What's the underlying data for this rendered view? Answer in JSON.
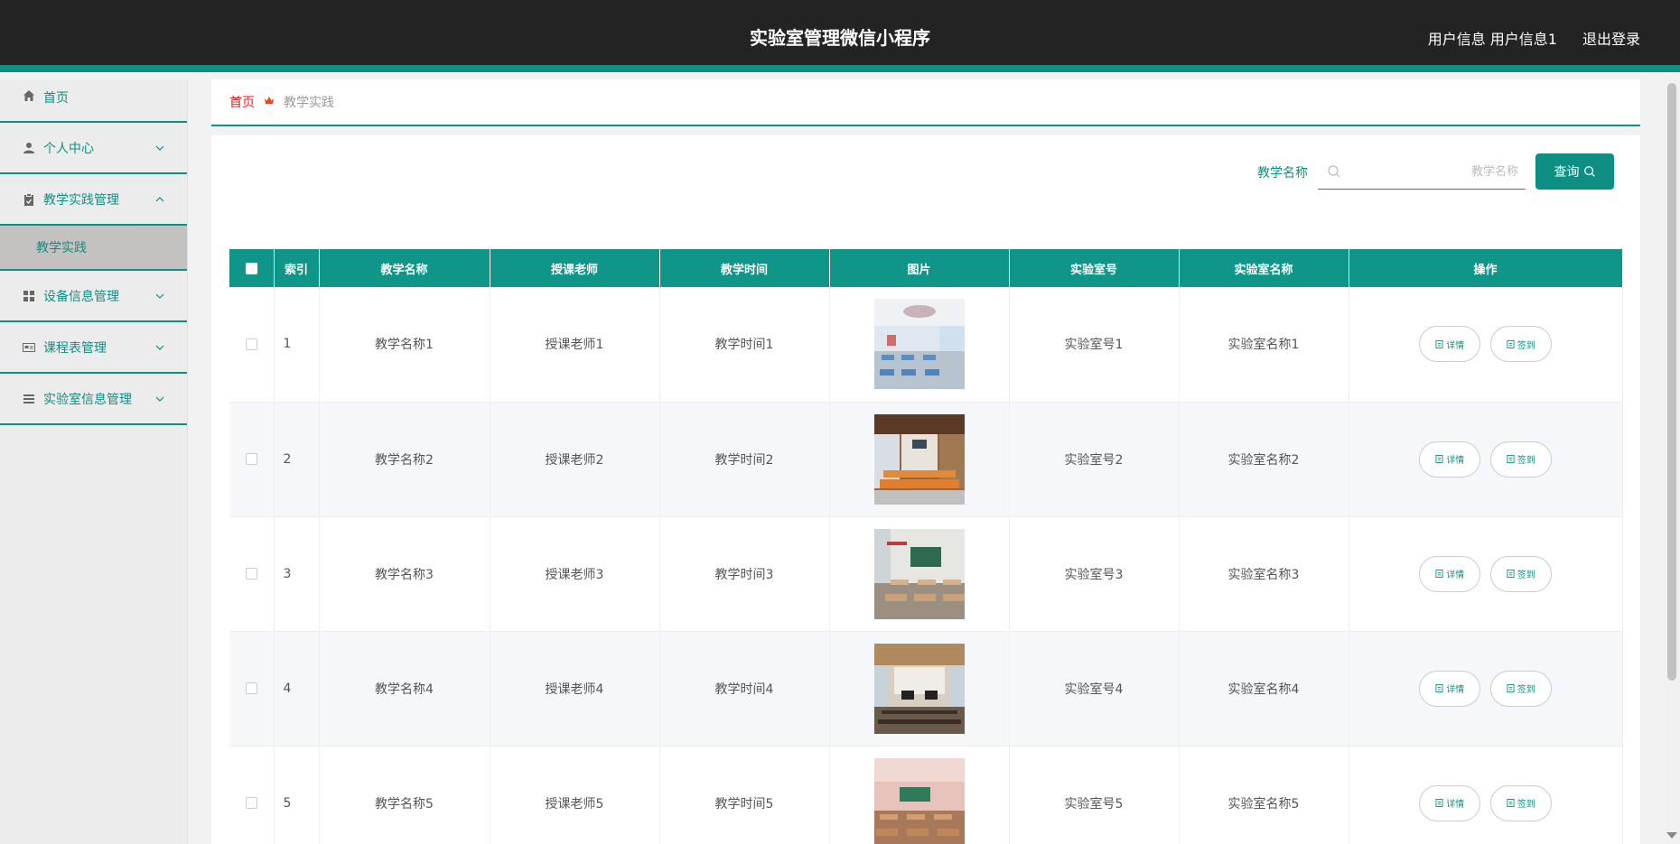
{
  "header": {
    "title": "实验室管理微信小程序",
    "user_info": "用户信息 用户信息1",
    "logout": "退出登录"
  },
  "sidebar": {
    "items": [
      {
        "label": "首页",
        "icon": "home-icon"
      },
      {
        "label": "个人中心",
        "icon": "user-icon",
        "expanded": false
      },
      {
        "label": "教学实践管理",
        "icon": "clipboard-icon",
        "expanded": true
      },
      {
        "label": "设备信息管理",
        "icon": "grid-icon",
        "expanded": false
      },
      {
        "label": "课程表管理",
        "icon": "card-icon",
        "expanded": false
      },
      {
        "label": "实验室信息管理",
        "icon": "list-icon",
        "expanded": false
      }
    ],
    "active_sub": "教学实践"
  },
  "breadcrumb": {
    "home": "首页",
    "current": "教学实践"
  },
  "search": {
    "label": "教学名称",
    "placeholder": "教学名称",
    "value": "",
    "button": "查询"
  },
  "table": {
    "columns": [
      "索引",
      "教学名称",
      "授课老师",
      "教学时间",
      "图片",
      "实验室号",
      "实验室名称",
      "操作"
    ],
    "rows": [
      {
        "index": "1",
        "name": "教学名称1",
        "teacher": "授课老师1",
        "time": "教学时间1",
        "lab_no": "实验室号1",
        "lab_name": "实验室名称1"
      },
      {
        "index": "2",
        "name": "教学名称2",
        "teacher": "授课老师2",
        "time": "教学时间2",
        "lab_no": "实验室号2",
        "lab_name": "实验室名称2"
      },
      {
        "index": "3",
        "name": "教学名称3",
        "teacher": "授课老师3",
        "time": "教学时间3",
        "lab_no": "实验室号3",
        "lab_name": "实验室名称3"
      },
      {
        "index": "4",
        "name": "教学名称4",
        "teacher": "授课老师4",
        "time": "教学时间4",
        "lab_no": "实验室号4",
        "lab_name": "实验室名称4"
      },
      {
        "index": "5",
        "name": "教学名称5",
        "teacher": "授课老师5",
        "time": "教学时间5",
        "lab_no": "实验室号5",
        "lab_name": "实验室名称5"
      }
    ],
    "actions": {
      "detail": "详情",
      "signin": "签到"
    }
  },
  "colors": {
    "accent": "#0f8f84",
    "header_bg": "#232323",
    "breadcrumb_home": "#e02020"
  }
}
